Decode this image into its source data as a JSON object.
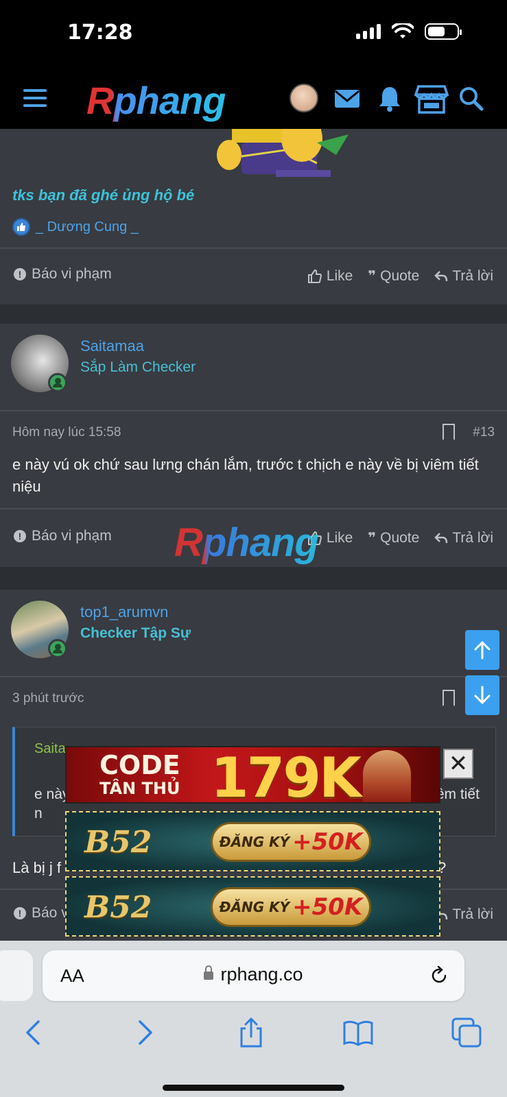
{
  "status_bar": {
    "time": "17:28"
  },
  "site": {
    "logo": "Rphang",
    "watermark": "Rphang"
  },
  "previous_post": {
    "signature": "tks bạn đã ghé ủng hộ bé",
    "reaction_user": "_ Dương Cung _",
    "report": "Báo vi phạm",
    "like": "Like",
    "quote": "Quote",
    "reply": "Trả lời"
  },
  "post_13": {
    "username": "Saitamaa",
    "user_title": "Sắp Làm Checker",
    "time": "Hôm nay lúc 15:58",
    "number": "#13",
    "body": "e này vú ok chứ sau lưng chán lắm, trước t chịch e này về bị viêm tiết niệu",
    "report": "Báo vi phạm",
    "like": "Like",
    "quote": "Quote",
    "reply": "Trả lời"
  },
  "post_14": {
    "username": "top1_arumvn",
    "user_title": "Checker Tập Sự",
    "time": "3 phút trước",
    "quote_author": "Saita",
    "quote_text": "e này vú ok chứ sau lưng chán lắm, trước t chịch e này về bị viêm tiết n",
    "body_start": "Là bị j f",
    "body_end": "?",
    "report": "Báo v",
    "reply": "Trả lời"
  },
  "ads": {
    "code_line1": "CODE",
    "code_line2": "TÂN THỦ",
    "code_amount": "179K",
    "close": "✕",
    "b52_brand": "B52",
    "b52_register": "ĐĂNG KÝ",
    "b52_bonus": "+50K"
  },
  "browser": {
    "text_size": "AA",
    "url": "rphang.co"
  },
  "colors": {
    "accent": "#4da3e8",
    "title": "#47c0d6",
    "online": "#3ba55c",
    "scroll_button": "#3ba0f0"
  }
}
